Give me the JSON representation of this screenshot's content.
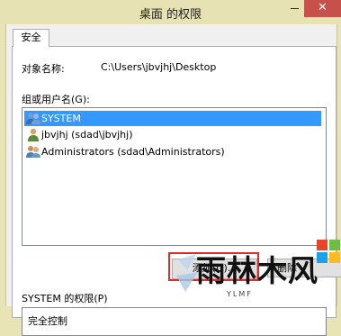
{
  "window": {
    "title": "桌面 的权限",
    "close_glyph": "✕"
  },
  "tabs": [
    {
      "label": "安全"
    }
  ],
  "object": {
    "label": "对象名称:",
    "value": "C:\\Users\\jbvjhj\\Desktop"
  },
  "group": {
    "label": "组或用户名(G):",
    "items": [
      {
        "label": "SYSTEM",
        "icon": "group-users-icon",
        "selected": true
      },
      {
        "label": "jbvjhj (sdad\\jbvjhj)",
        "icon": "user-icon",
        "selected": false
      },
      {
        "label": "Administrators (sdad\\Administrators)",
        "icon": "group-users-icon",
        "selected": false
      }
    ]
  },
  "buttons": {
    "add": "添加(D)...",
    "remove": "删除"
  },
  "permissions": {
    "label": "SYSTEM 的权限(P)",
    "rows": [
      {
        "label": "完全控制"
      }
    ]
  },
  "watermark": {
    "text": "雨林木风",
    "small": "YLMF"
  }
}
